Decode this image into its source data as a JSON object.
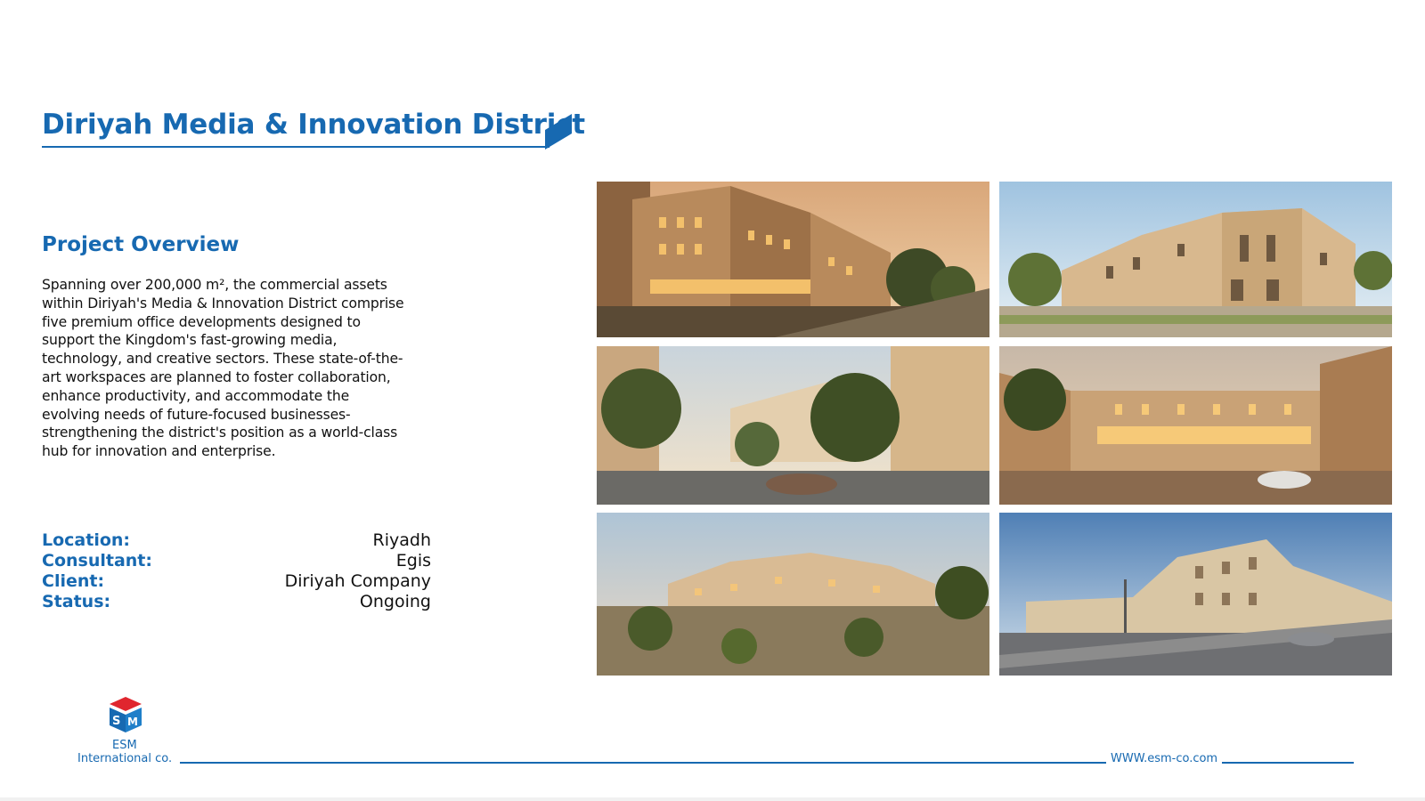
{
  "title": "Diriyah Media & Innovation District",
  "overview": {
    "heading": "Project Overview",
    "text": "Spanning over 200,000 m², the commercial assets within Diriyah's Media & Innovation District comprise five premium office developments designed to support the Kingdom's fast-growing media, technology, and creative sectors. These state-of-the-art workspaces are planned to foster collaboration, enhance productivity, and accommodate the evolving needs of future-focused businesses-strengthening the district's position as a world-class hub for innovation and enterprise."
  },
  "details": [
    {
      "label": "Location:",
      "value": "Riyadh"
    },
    {
      "label": "Consultant:",
      "value": "Egis"
    },
    {
      "label": "Client:",
      "value": "Diriyah Company"
    },
    {
      "label": "Status:",
      "value": "Ongoing"
    }
  ],
  "footer": {
    "logo_name": "ESM",
    "logo_sub": "International co.",
    "url": "WWW.esm-co.com"
  },
  "colors": {
    "accent": "#1769b1",
    "logo_red": "#e0262e"
  },
  "icons": {
    "title_accent": "parallelogram-accent-icon",
    "logo": "esm-logo-icon"
  }
}
